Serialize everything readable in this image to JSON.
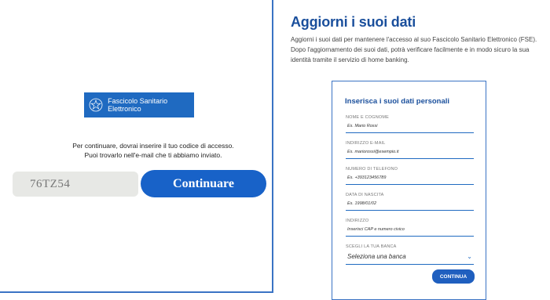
{
  "left": {
    "logo_text": "Fascicolo Sanitario Elettronico",
    "instruction_line1": "Per continuare, dovrai inserire il tuo codice di accesso.",
    "instruction_line2": "Puoi trovarlo nell'e-mail che ti abbiamo inviato.",
    "code_value": "76TZ54",
    "continue_label": "Continuare"
  },
  "right": {
    "title": "Aggiorni i suoi dati",
    "intro": "Aggiorni i suoi dati per mantenere l'accesso al suo Fascicolo Sanitario Elettronico (FSE). Dopo l'aggiornamento dei suoi dati, potrà verificare facilmente e in modo sicuro la sua identità tramite il servizio di home banking.",
    "form": {
      "title": "Inserisca i suoi dati personali",
      "fields": [
        {
          "label": "NOME E COGNOME",
          "placeholder": "Es. Mario Rossi"
        },
        {
          "label": "INDIRIZZO E-MAIL",
          "placeholder": "Es. mariorossi@esempio.it"
        },
        {
          "label": "NUMERO DI TELEFONO",
          "placeholder": "Es. +393123456789"
        },
        {
          "label": "DATA DI NASCITA",
          "placeholder": "Es. 1998/01/02"
        },
        {
          "label": "INDIRIZZO",
          "placeholder": "Inserisci CAP e numero civico"
        }
      ],
      "bank_label": "SCEGLI LA TUA BANCA",
      "bank_selected": "Seleziona una banca",
      "submit_label": "CONTINUA"
    }
  },
  "colors": {
    "brand_blue": "#1862c8",
    "heading_blue": "#1a4f9c",
    "border_blue": "#3a73c4"
  }
}
